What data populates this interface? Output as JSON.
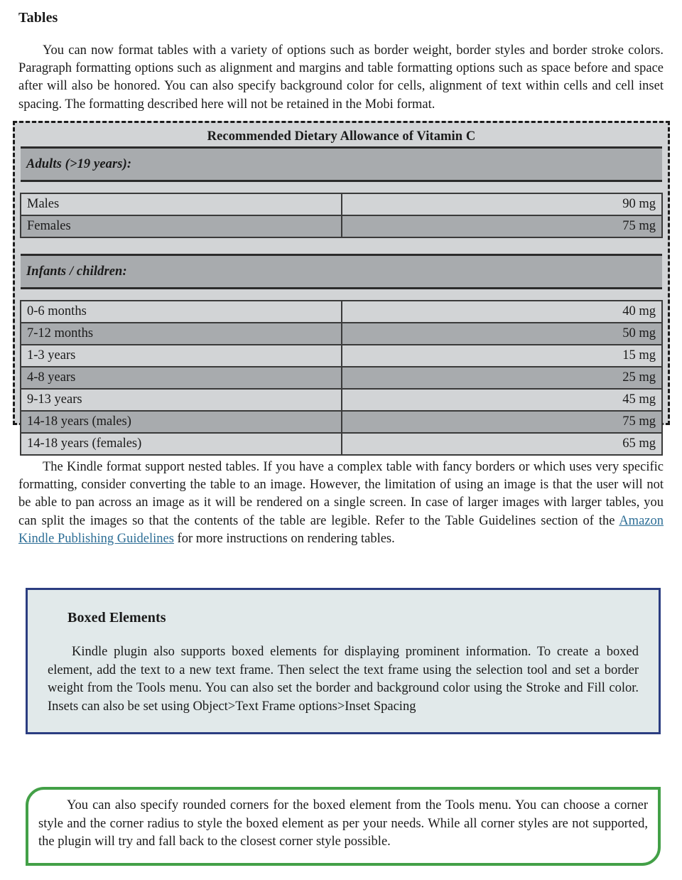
{
  "section": {
    "heading": "Tables",
    "intro_paragraph": "You can now format tables with a variety of options such as border weight, border styles and border stroke colors. Paragraph formatting options such as alignment and margins and table formatting options such as space before and space after will also be honored. You can also specify background color for cells, alignment of text within cells and cell inset spacing. The formatting described here will not be retained in the Mobi format."
  },
  "table": {
    "title": "Recommended Dietary Allowance of Vitamin C",
    "groups": [
      {
        "label": "Adults (>19 years):",
        "rows": [
          {
            "label": "Males",
            "value": "90 mg"
          },
          {
            "label": "Females",
            "value": "75 mg"
          }
        ]
      },
      {
        "label": "Infants / children:",
        "rows": [
          {
            "label": "0-6 months",
            "value": "40 mg"
          },
          {
            "label": "7-12 months",
            "value": "50 mg"
          },
          {
            "label": "1-3 years",
            "value": "15 mg"
          },
          {
            "label": "4-8 years",
            "value": "25 mg"
          },
          {
            "label": "9-13 years",
            "value": "45 mg"
          },
          {
            "label": "14-18 years (males)",
            "value": "75 mg"
          },
          {
            "label": "14-18 years (females)",
            "value": "65 mg"
          }
        ]
      }
    ],
    "colors": {
      "row_light": "#d2d4d6",
      "row_dark": "#a8abae",
      "border": "#3a3a3a",
      "outer_dashed_border": "#1c1c1c"
    }
  },
  "after_table": {
    "text_before_link": "The Kindle format support nested tables. If you have a complex table with fancy borders or which uses very specific formatting, consider converting the table to an image. However, the limitation of using an image is that the user will not be able to pan across an image as it will be rendered on a single screen. In case of larger images with larger tables, you can split the images so that the contents of the table are legible. Refer to the Table Guidelines section of the ",
    "link_label": "Amazon Kindle Publishing Guidelines",
    "text_after_link": " for more instructions on rendering tables.",
    "link_color": "#2d6e96"
  },
  "boxed_element": {
    "title": "Boxed Elements",
    "paragraph": "Kindle plugin also supports boxed elements for displaying prominent information. To create a boxed element, add the text to a new text frame. Then select the text frame using the selection tool and set a border weight from the Tools menu. You can also set the border and background color using the Stroke and Fill color. Insets can also be set using Object>Text Frame options>Inset Spacing",
    "border_color": "#2b3d81",
    "background_color": "#e1e9ea"
  },
  "rounded_box": {
    "paragraph": "You can also specify rounded corners for the boxed element from the Tools menu. You can choose a corner style and the corner radius to style the boxed element as per your needs. While all corner styles are not supported, the plugin will try and fall back to the closest corner style possible.",
    "border_color": "#43a047"
  }
}
